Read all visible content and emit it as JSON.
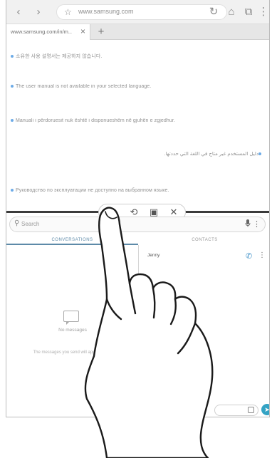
{
  "browser": {
    "url": "www.samsung.com",
    "tab_title": "www.samsung.com/in/m...",
    "tab_close": "×",
    "new_tab": "+",
    "icons": {
      "back": "‹",
      "forward": "›",
      "star": "☆",
      "reload": "↻",
      "home": "⌂",
      "tabs": "⧉",
      "more": "⋮"
    }
  },
  "page": {
    "lines": [
      "소유한 사용 설명서는 제공하지 않습니다.",
      "The user manual is not available in your selected language.",
      "Manuali i përdoruesit nuk është i disponueshëm në gjuhën e zgjedhur.",
      "دليل المستخدم غير متاح في اللغة التي حددتها.",
      "Руководство по эксплуатации не доступно на выбранном языке."
    ]
  },
  "split_controls": {
    "icons": [
      "app-switch-icon",
      "swap-icon",
      "window-mode-icon",
      "close-icon"
    ],
    "glyphs": [
      "⊙",
      "⟲",
      "▣",
      "✕"
    ]
  },
  "messages": {
    "search_placeholder": "Search",
    "tabs": [
      "CONVERSATIONS",
      "CONTACTS"
    ],
    "no_messages": "No messages",
    "no_messages_sub": "The messages you send will appear here.",
    "contact_name": "Jenny",
    "icons": {
      "search": "⚲",
      "mic": "🎤",
      "more": "⋮",
      "call": "✆",
      "send": "➤"
    }
  }
}
